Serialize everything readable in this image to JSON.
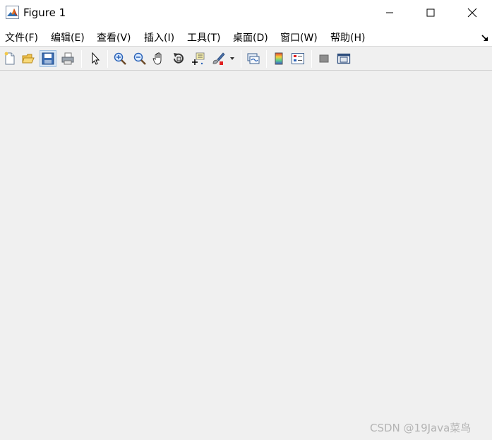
{
  "window": {
    "title": "Figure 1",
    "icon": "matlab-icon",
    "controls": [
      "minimize-icon",
      "maximize-icon",
      "close-icon"
    ]
  },
  "menu": {
    "items": [
      {
        "label": "文件(F)"
      },
      {
        "label": "编辑(E)"
      },
      {
        "label": "查看(V)"
      },
      {
        "label": "插入(I)"
      },
      {
        "label": "工具(T)"
      },
      {
        "label": "桌面(D)"
      },
      {
        "label": "窗口(W)"
      },
      {
        "label": "帮助(H)"
      }
    ],
    "dock_icon": "dock-arrow-icon"
  },
  "toolbar": {
    "buttons": [
      "new-figure-icon",
      "open-file-icon",
      "save-icon",
      "print-icon",
      "edit-plot-icon",
      "zoom-in-icon",
      "zoom-out-icon",
      "pan-icon",
      "rotate-3d-icon",
      "data-cursor-icon",
      "brush-icon",
      "brush-dropdown-icon",
      "link-plot-icon",
      "insert-colorbar-icon",
      "insert-legend-icon",
      "hide-plot-tools-icon",
      "show-plot-tools-icon"
    ],
    "colors": {
      "accent_blue": "#3c6eb4",
      "brush_red": "#e02020",
      "zoom_blue": "#2a62b8"
    }
  },
  "watermark": {
    "text": "CSDN @19Java菜鸟"
  }
}
